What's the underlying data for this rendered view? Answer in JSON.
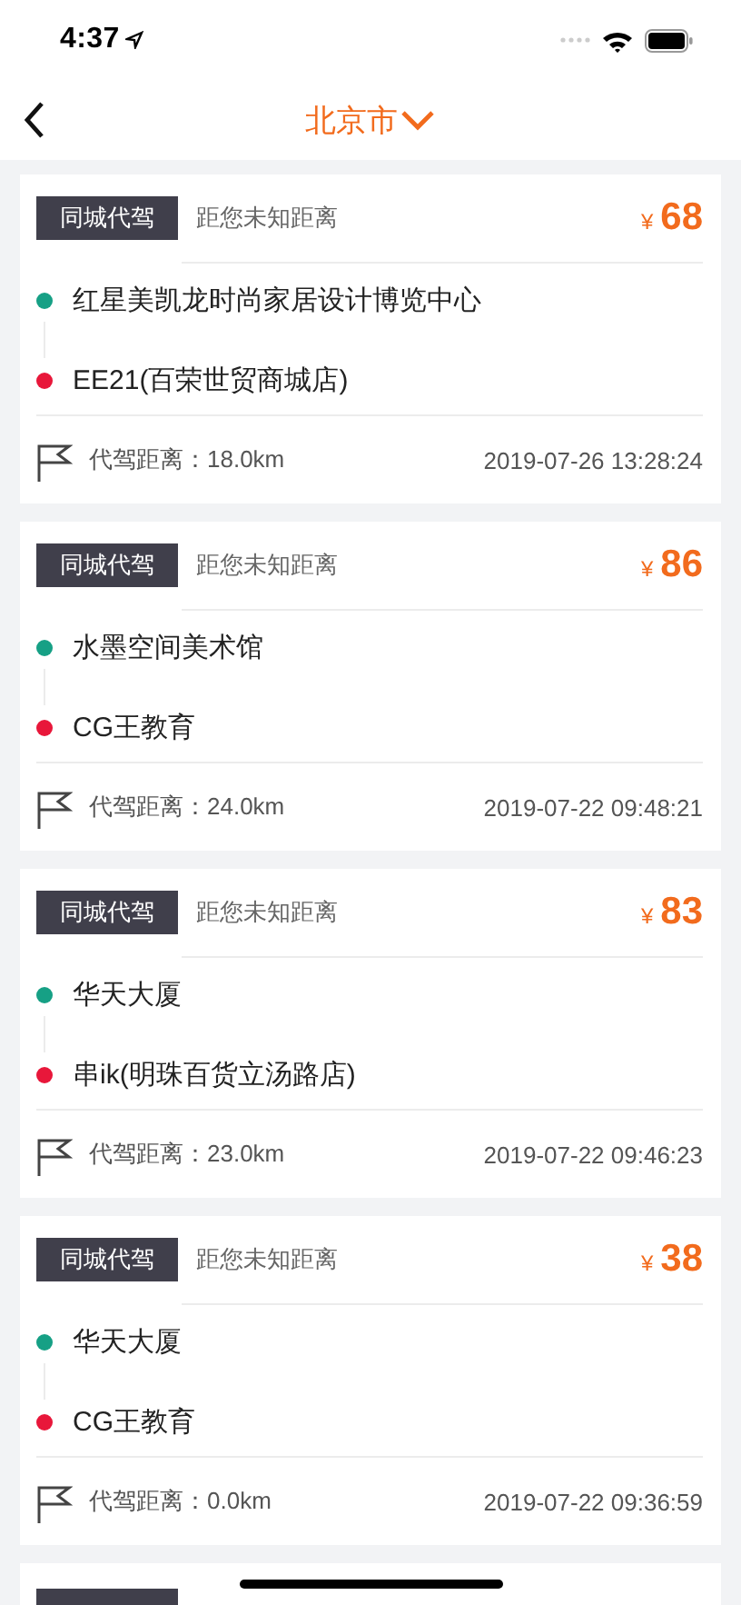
{
  "status_bar": {
    "time": "4:37"
  },
  "nav": {
    "title": "北京市"
  },
  "orders": [
    {
      "tag": "同城代驾",
      "distance_to_you": "距您未知距离",
      "currency": "¥",
      "price": "68",
      "start": "红星美凯龙时尚家居设计博览中心",
      "end": "EE21(百荣世贸商城店)",
      "drive_distance": "代驾距离：18.0km",
      "time": "2019-07-26 13:28:24"
    },
    {
      "tag": "同城代驾",
      "distance_to_you": "距您未知距离",
      "currency": "¥",
      "price": "86",
      "start": "水墨空间美术馆",
      "end": "CG王教育",
      "drive_distance": "代驾距离：24.0km",
      "time": "2019-07-22 09:48:21"
    },
    {
      "tag": "同城代驾",
      "distance_to_you": "距您未知距离",
      "currency": "¥",
      "price": "83",
      "start": "华天大厦",
      "end": "串ik(明珠百货立汤路店)",
      "drive_distance": "代驾距离：23.0km",
      "time": "2019-07-22 09:46:23"
    },
    {
      "tag": "同城代驾",
      "distance_to_you": "距您未知距离",
      "currency": "¥",
      "price": "38",
      "start": "华天大厦",
      "end": "CG王教育",
      "drive_distance": "代驾距离：0.0km",
      "time": "2019-07-22 09:36:59"
    }
  ]
}
